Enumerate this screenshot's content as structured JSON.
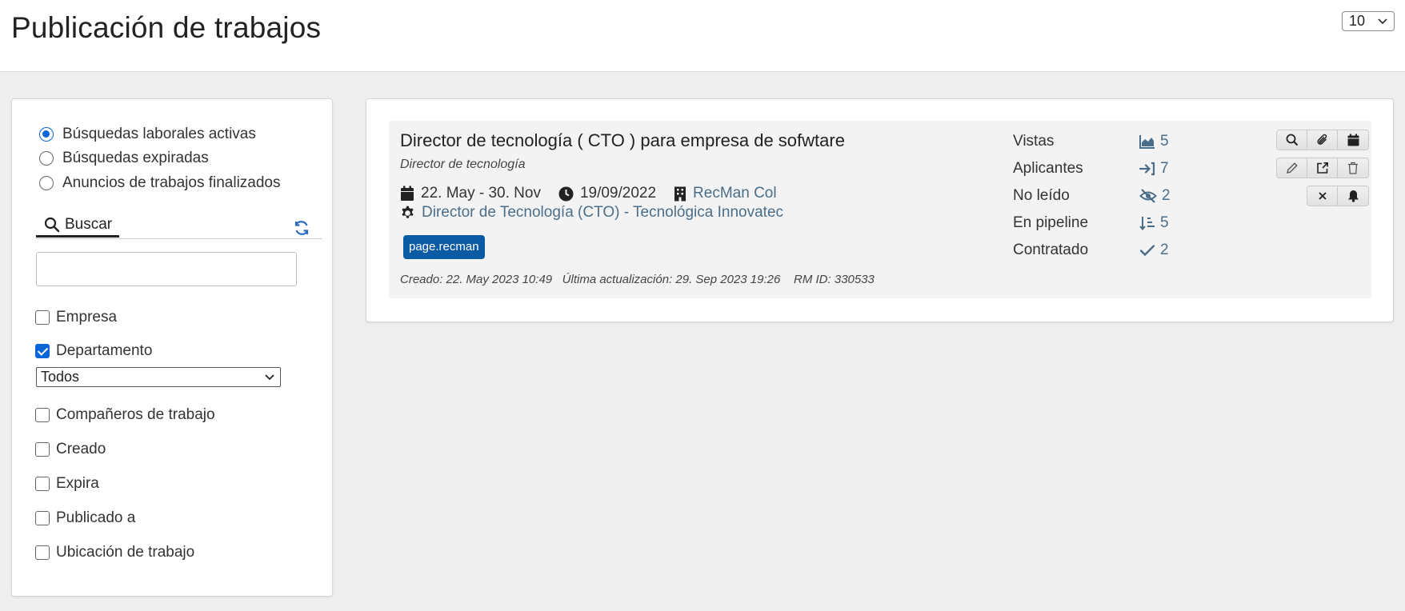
{
  "header": {
    "title": "Publicación de trabajos",
    "page_size": "10"
  },
  "sidebar": {
    "radios": [
      {
        "label": "Búsquedas laborales activas",
        "checked": true
      },
      {
        "label": "Búsquedas expiradas",
        "checked": false
      },
      {
        "label": "Anuncios de trabajos finalizados",
        "checked": false
      }
    ],
    "search_tab": "Buscar",
    "search_value": "",
    "filters": [
      {
        "label": "Empresa",
        "checked": false
      },
      {
        "label": "Departamento",
        "checked": true
      },
      {
        "label": "Compañeros de trabajo",
        "checked": false
      },
      {
        "label": "Creado",
        "checked": false
      },
      {
        "label": "Expira",
        "checked": false
      },
      {
        "label": "Publicado a",
        "checked": false
      },
      {
        "label": "Ubicación de trabajo",
        "checked": false
      }
    ],
    "department_select": "Todos"
  },
  "job": {
    "title": "Director de tecnología ( CTO ) para empresa de sofwtare",
    "subtitle": "Director de tecnología",
    "date_range": "22. May - 30. Nov",
    "date": "19/09/2022",
    "company": "RecMan Col",
    "project": "Director de Tecnología (CTO) - Tecnológica Innovatec",
    "badge": "page.recman",
    "created": "Creado: 22. May 2023 10:49",
    "updated": "Última actualización: 29. Sep 2023 19:26",
    "rm_id": "RM ID: 330533",
    "stats": [
      {
        "label": "Vistas",
        "value": "5",
        "icon": "chart-area-icon"
      },
      {
        "label": "Aplicantes",
        "value": "7",
        "icon": "sign-in-icon"
      },
      {
        "label": "No leído",
        "value": "2",
        "icon": "eye-slash-icon"
      },
      {
        "label": "En pipeline",
        "value": "5",
        "icon": "sort-amount-down-icon"
      },
      {
        "label": "Contratado",
        "value": "2",
        "icon": "check-icon"
      }
    ]
  },
  "colors": {
    "accent": "#0a66d6",
    "badge": "#0a5aa4",
    "link": "#4a6e8a"
  }
}
